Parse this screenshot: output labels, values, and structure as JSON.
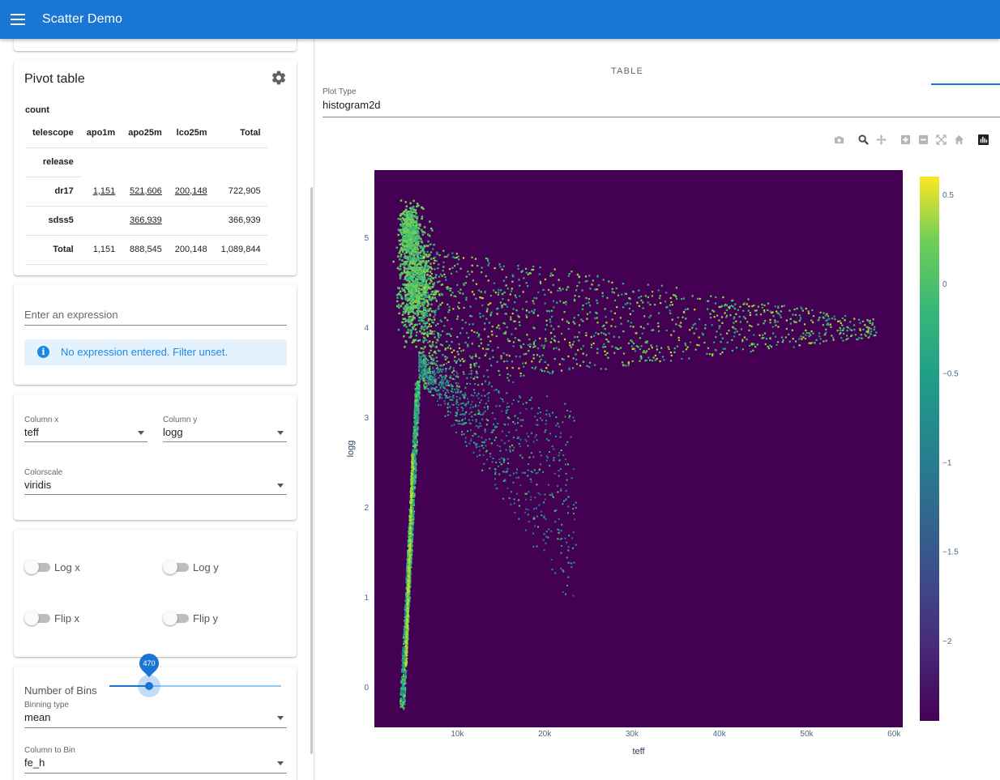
{
  "app": {
    "title": "Scatter Demo"
  },
  "pivot": {
    "title": "Pivot table",
    "count_label": "count",
    "column_header": "telescope",
    "columns": [
      "apo1m",
      "apo25m",
      "lco25m",
      "Total"
    ],
    "row_header": "release",
    "rows": [
      {
        "label": "dr17",
        "values": [
          "1,151",
          "521,606",
          "200,148",
          "722,905"
        ]
      },
      {
        "label": "sdss5",
        "values": [
          "",
          "366,939",
          "",
          "366,939"
        ]
      },
      {
        "label": "Total",
        "values": [
          "1,151",
          "888,545",
          "200,148",
          "1,089,844"
        ]
      }
    ]
  },
  "filter": {
    "placeholder": "Enter an expression",
    "info": "No expression entered. Filter unset."
  },
  "columns": {
    "x_label": "Column x",
    "x_value": "teff",
    "y_label": "Column y",
    "y_value": "logg",
    "colorscale_label": "Colorscale",
    "colorscale_value": "viridis"
  },
  "toggles": {
    "log_x": "Log x",
    "log_y": "Log y",
    "flip_x": "Flip x",
    "flip_y": "Flip y"
  },
  "binning": {
    "bins_label": "Number of Bins",
    "bins_value": "470",
    "bins_fraction": 0.23,
    "type_label": "Binning type",
    "type_value": "mean",
    "column_label": "Column to Bin",
    "column_value": "fe_h"
  },
  "tabs": {
    "table": "TABLE"
  },
  "plot_type": {
    "label": "Plot Type",
    "value": "histogram2d"
  },
  "modebar": [
    "camera-icon",
    "zoom-icon",
    "pan-icon",
    "zoom-in-icon",
    "zoom-out-icon",
    "autoscale-icon",
    "reset-axes-icon",
    "plotly-logo-icon"
  ],
  "chart_data": {
    "type": "heatmap",
    "subtype": "histogram2d",
    "title": "",
    "xlabel": "teff",
    "ylabel": "logg",
    "x_ticks": [
      "10k",
      "20k",
      "30k",
      "40k",
      "50k",
      "60k"
    ],
    "x_tick_values": [
      10000,
      20000,
      30000,
      40000,
      50000,
      60000
    ],
    "y_ticks": [
      "0",
      "1",
      "2",
      "3",
      "4",
      "5"
    ],
    "y_tick_values": [
      0,
      1,
      2,
      3,
      4,
      5
    ],
    "xlim": [
      500,
      61000
    ],
    "ylim": [
      -0.45,
      5.75
    ],
    "colorscale": "viridis",
    "background_color": "#440154",
    "colorbar_ticks": [
      "0.5",
      "0",
      "−0.5",
      "−1",
      "−1.5",
      "−2"
    ],
    "colorbar_tick_values": [
      0.5,
      0,
      -0.5,
      -1,
      -1.5,
      -2
    ],
    "colorbar_range": [
      -2.45,
      0.6
    ],
    "z_variable": "fe_h",
    "aggregation": "mean",
    "bins": 470
  }
}
